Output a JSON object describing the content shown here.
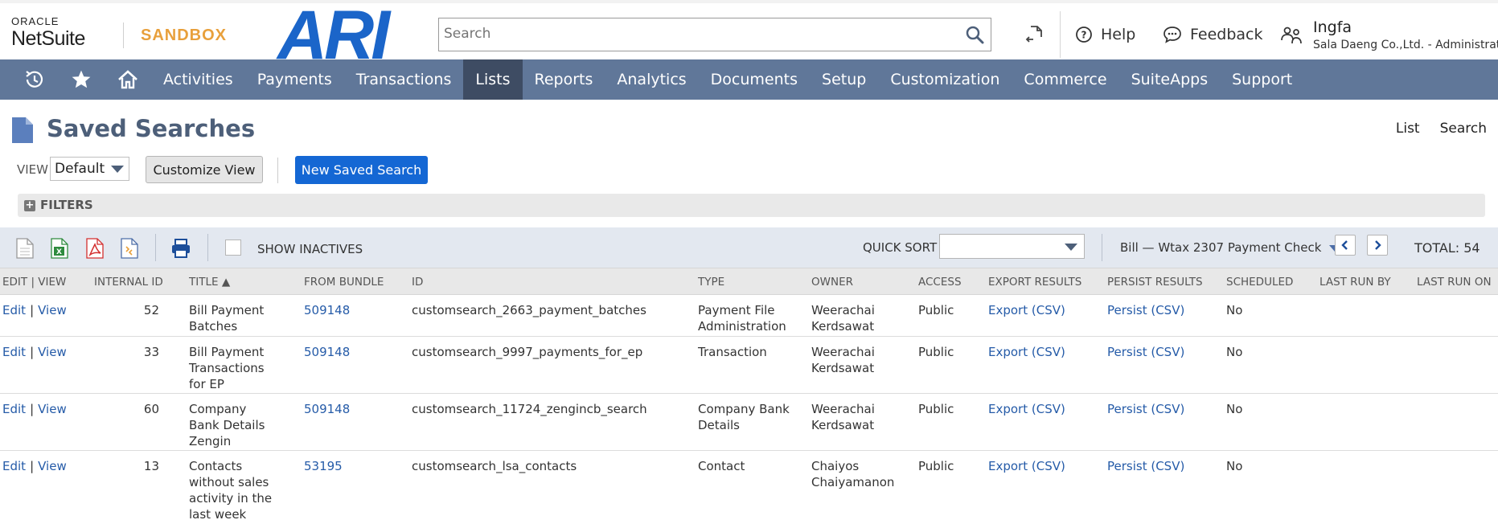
{
  "header": {
    "oracle": "ORACLE",
    "netsuite": "NetSuite",
    "sandbox": "SANDBOX",
    "brand": "ARI",
    "search_placeholder": "Search",
    "help": "Help",
    "feedback": "Feedback",
    "user_name": "Ingfa",
    "user_sub": "Sala Daeng Co.,Ltd. - Administrator"
  },
  "nav": {
    "items": [
      "Activities",
      "Payments",
      "Transactions",
      "Lists",
      "Reports",
      "Analytics",
      "Documents",
      "Setup",
      "Customization",
      "Commerce",
      "SuiteApps",
      "Support"
    ],
    "active": "Lists",
    "color": "#607799",
    "active_color": "#3e4c63"
  },
  "page": {
    "title": "Saved Searches",
    "link_list": "List",
    "link_search": "Search",
    "view_label": "VIEW",
    "view_value": "Default",
    "customize_view": "Customize View",
    "new_saved_search": "New Saved Search",
    "filters": "FILTERS"
  },
  "toolbar": {
    "show_inactives": "SHOW INACTIVES",
    "quick_sort": "QUICK SORT",
    "quick_sort_value": "",
    "page_range": "Bill — Wtax 2307 Payment Check",
    "total": "TOTAL: 54"
  },
  "table": {
    "columns": [
      "EDIT | VIEW",
      "INTERNAL ID",
      "TITLE ▲",
      "FROM BUNDLE",
      "ID",
      "TYPE",
      "OWNER",
      "ACCESS",
      "EXPORT RESULTS",
      "PERSIST RESULTS",
      "SCHEDULED",
      "LAST RUN BY",
      "LAST RUN ON"
    ],
    "edit": "Edit",
    "view": "View",
    "rows": [
      {
        "internal_id": "52",
        "title": "Bill Payment Batches",
        "bundle": "509148",
        "id": "customsearch_2663_payment_batches",
        "type": "Payment File Administration",
        "owner": "Weerachai Kerdsawat",
        "access": "Public",
        "export": "Export (CSV)",
        "persist": "Persist (CSV)",
        "scheduled": "No"
      },
      {
        "internal_id": "33",
        "title": "Bill Payment Transactions for EP",
        "bundle": "509148",
        "id": "customsearch_9997_payments_for_ep",
        "type": "Transaction",
        "owner": "Weerachai Kerdsawat",
        "access": "Public",
        "export": "Export (CSV)",
        "persist": "Persist (CSV)",
        "scheduled": "No"
      },
      {
        "internal_id": "60",
        "title": "Company Bank Details Zengin",
        "bundle": "509148",
        "id": "customsearch_11724_zengincb_search",
        "type": "Company Bank Details",
        "owner": "Weerachai Kerdsawat",
        "access": "Public",
        "export": "Export (CSV)",
        "persist": "Persist (CSV)",
        "scheduled": "No"
      },
      {
        "internal_id": "13",
        "title": "Contacts without sales activity in the last week",
        "bundle": "53195",
        "id": "customsearch_lsa_contacts",
        "type": "Contact",
        "owner": "Chaiyos Chaiyamanon",
        "access": "Public",
        "export": "Export (CSV)",
        "persist": "Persist (CSV)",
        "scheduled": "No"
      }
    ]
  }
}
